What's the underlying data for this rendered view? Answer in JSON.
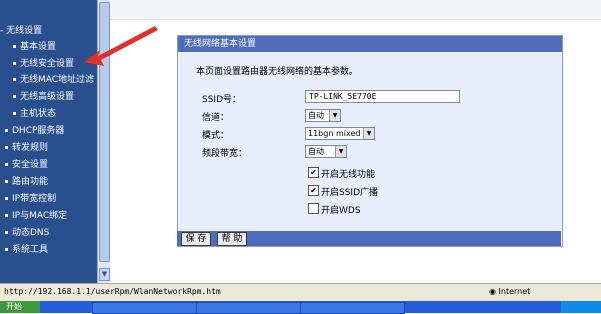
{
  "sidebar": {
    "items": [
      {
        "label": "- 无线设置",
        "sub": false,
        "active": false
      },
      {
        "label": "基本设置",
        "sub": true,
        "active": false
      },
      {
        "label": "无线安全设置",
        "sub": true,
        "active": false
      },
      {
        "label": "无线MAC地址过滤",
        "sub": true,
        "active": false
      },
      {
        "label": "无线高级设置",
        "sub": true,
        "active": false
      },
      {
        "label": "主机状态",
        "sub": true,
        "active": false
      },
      {
        "label": "DHCP服务器",
        "sub": false,
        "active": false
      },
      {
        "label": "转发规则",
        "sub": false,
        "active": false
      },
      {
        "label": "安全设置",
        "sub": false,
        "active": false
      },
      {
        "label": "路由功能",
        "sub": false,
        "active": false
      },
      {
        "label": "IP带宽控制",
        "sub": false,
        "active": false
      },
      {
        "label": "IP与MAC绑定",
        "sub": false,
        "active": false
      },
      {
        "label": "动态DNS",
        "sub": false,
        "active": false
      },
      {
        "label": "系统工具",
        "sub": false,
        "active": false
      }
    ]
  },
  "panel": {
    "title": "无线网络基本设置",
    "description": "本页面设置路由器无线网络的基本参数。",
    "ssid_label": "SSID号：",
    "ssid_value": "TP-LINK_5E770E",
    "channel_label": "信道：",
    "channel_value": "自动",
    "mode_label": "模式：",
    "mode_value": "11bgn mixed",
    "bandwidth_label": "频段带宽：",
    "bandwidth_value": "自动",
    "checkboxes": [
      {
        "label": "开启无线功能",
        "checked": true
      },
      {
        "label": "开启SSID广播",
        "checked": true
      },
      {
        "label": "开启WDS",
        "checked": false
      }
    ],
    "save_label": "保 存",
    "help_label": "帮 助"
  },
  "statusbar": {
    "url": "http://192.168.1.1/userRpm/WlanNetworkRpm.htm",
    "zone": "Internet"
  },
  "taskbar": {
    "start_label": "开始"
  },
  "colors": {
    "sidebar_bg": "#2a4f8e",
    "panel_title_bg": "#4d6dba",
    "panel_body_bg": "#e8eefb",
    "annotation_arrow": "#e0302a"
  }
}
